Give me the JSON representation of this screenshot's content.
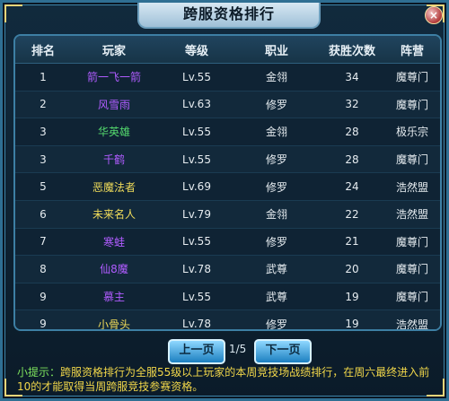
{
  "window": {
    "title": "跨服资格排行",
    "close_label": "×"
  },
  "table": {
    "headers": [
      "排名",
      "玩家",
      "等级",
      "职业",
      "获胜次数",
      "阵营"
    ],
    "rows": [
      {
        "rank": "1",
        "player": "箭一飞一箭",
        "player_color": "#b05cff",
        "level": "Lv.55",
        "class": "金翎",
        "wins": "34",
        "faction": "魔尊门"
      },
      {
        "rank": "2",
        "player": "风雪雨",
        "player_color": "#b05cff",
        "level": "Lv.63",
        "class": "修罗",
        "wins": "32",
        "faction": "魔尊门"
      },
      {
        "rank": "3",
        "player": "华英雄",
        "player_color": "#54d96d",
        "level": "Lv.55",
        "class": "金翎",
        "wins": "28",
        "faction": "极乐宗"
      },
      {
        "rank": "3",
        "player": "千鹤",
        "player_color": "#b05cff",
        "level": "Lv.55",
        "class": "修罗",
        "wins": "28",
        "faction": "魔尊门"
      },
      {
        "rank": "5",
        "player": "恶魔法者",
        "player_color": "#f0dc5a",
        "level": "Lv.69",
        "class": "修罗",
        "wins": "24",
        "faction": "浩然盟"
      },
      {
        "rank": "6",
        "player": "未来名人",
        "player_color": "#f0dc5a",
        "level": "Lv.79",
        "class": "金翎",
        "wins": "22",
        "faction": "浩然盟"
      },
      {
        "rank": "7",
        "player": "寒蛙",
        "player_color": "#b05cff",
        "level": "Lv.55",
        "class": "修罗",
        "wins": "21",
        "faction": "魔尊门"
      },
      {
        "rank": "8",
        "player": "仙8魔",
        "player_color": "#b05cff",
        "level": "Lv.78",
        "class": "武尊",
        "wins": "20",
        "faction": "魔尊门"
      },
      {
        "rank": "9",
        "player": "慕主",
        "player_color": "#b05cff",
        "level": "Lv.55",
        "class": "武尊",
        "wins": "19",
        "faction": "魔尊门"
      },
      {
        "rank": "9",
        "player": "小骨头",
        "player_color": "#f0dc5a",
        "level": "Lv.78",
        "class": "修罗",
        "wins": "19",
        "faction": "浩然盟"
      }
    ]
  },
  "pager": {
    "prev_label": "上一页",
    "next_label": "下一页",
    "page_text": "1/5"
  },
  "tip": {
    "prefix": "小提示：",
    "text": "跨服资格排行为全服55级以上玩家的本周竞技场战绩排行，在周六最终进入前10的才能取得当周跨服竞技参赛资格。"
  }
}
